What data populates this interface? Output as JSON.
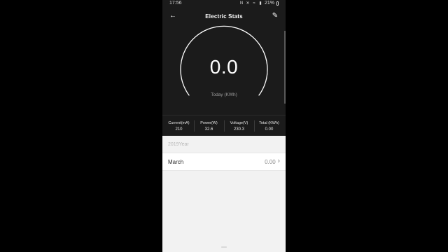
{
  "status_bar": {
    "time": "17:56",
    "battery": "21%",
    "icons": [
      "nfc-icon",
      "mute-icon",
      "wifi-icon",
      "signal-icon",
      "battery-icon"
    ]
  },
  "header": {
    "title": "Electric Stats",
    "back_icon": "back-arrow-icon",
    "edit_icon": "edit-icon"
  },
  "gauge": {
    "value": "0.0",
    "caption": "Today (KWh)"
  },
  "stats": [
    {
      "label": "Current(mA)",
      "value": "210"
    },
    {
      "label": "Power(W)",
      "value": "32.6"
    },
    {
      "label": "Voltage(V)",
      "value": "230.3"
    },
    {
      "label": "Total (KWh)",
      "value": "0.00"
    }
  ],
  "history": {
    "year_label": "2019Year",
    "months": [
      {
        "name": "March",
        "value": "0.00"
      }
    ]
  },
  "colors": {
    "background": "#000000",
    "app_dark": "#1b1b1b",
    "panel_light": "#f2f2f2"
  }
}
